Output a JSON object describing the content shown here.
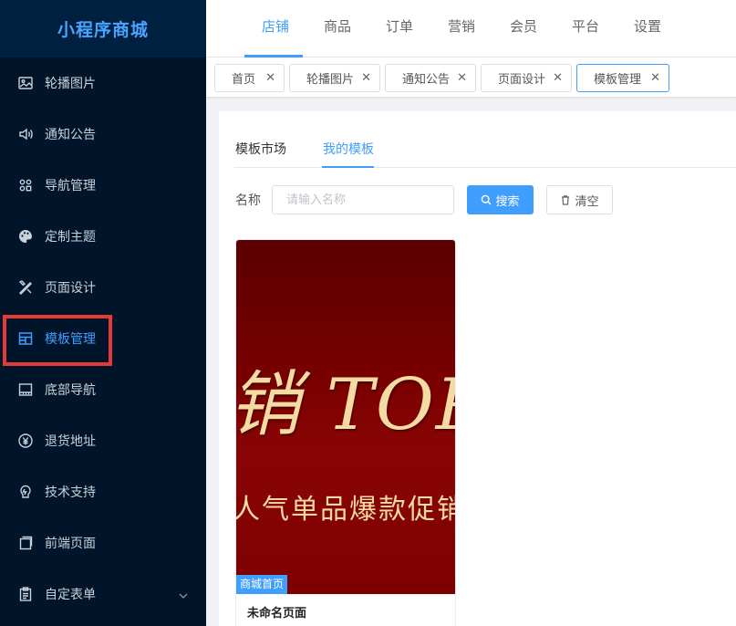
{
  "app": {
    "title": "小程序商城"
  },
  "sidebar": {
    "items": [
      {
        "label": "轮播图片",
        "icon": "image-icon"
      },
      {
        "label": "通知公告",
        "icon": "speaker-icon"
      },
      {
        "label": "导航管理",
        "icon": "grid-icon"
      },
      {
        "label": "定制主题",
        "icon": "palette-icon"
      },
      {
        "label": "页面设计",
        "icon": "design-tools-icon"
      },
      {
        "label": "模板管理",
        "icon": "template-icon",
        "active": true
      },
      {
        "label": "底部导航",
        "icon": "bottom-bar-icon"
      },
      {
        "label": "退货地址",
        "icon": "yen-refund-icon"
      },
      {
        "label": "技术支持",
        "icon": "support-icon"
      },
      {
        "label": "前端页面",
        "icon": "pages-icon"
      },
      {
        "label": "自定表单",
        "icon": "clipboard-icon",
        "has_submenu": true
      }
    ]
  },
  "topnav": {
    "items": [
      {
        "label": "店铺",
        "active": true
      },
      {
        "label": "商品"
      },
      {
        "label": "订单"
      },
      {
        "label": "营销"
      },
      {
        "label": "会员"
      },
      {
        "label": "平台"
      },
      {
        "label": "设置"
      }
    ]
  },
  "tags": [
    {
      "label": "首页"
    },
    {
      "label": "轮播图片"
    },
    {
      "label": "通知公告"
    },
    {
      "label": "页面设计"
    },
    {
      "label": "模板管理",
      "active": true
    }
  ],
  "content": {
    "tabs": [
      {
        "label": "模板市场"
      },
      {
        "label": "我的模板",
        "active": true
      }
    ],
    "search": {
      "label": "名称",
      "placeholder": "请输入名称",
      "value": "",
      "search_button": "搜索",
      "clear_button": "清空"
    },
    "templates": [
      {
        "badge": "商城首页",
        "title": "未命名页面",
        "image_text_main": "销 TOP",
        "image_text_sub": "人气单品爆款促销"
      }
    ]
  },
  "colors": {
    "sidebar_bg": "#001529",
    "accent": "#409eff",
    "highlight": "#e53935",
    "card_red": "#7a0000",
    "card_text": "#f4dba3"
  }
}
